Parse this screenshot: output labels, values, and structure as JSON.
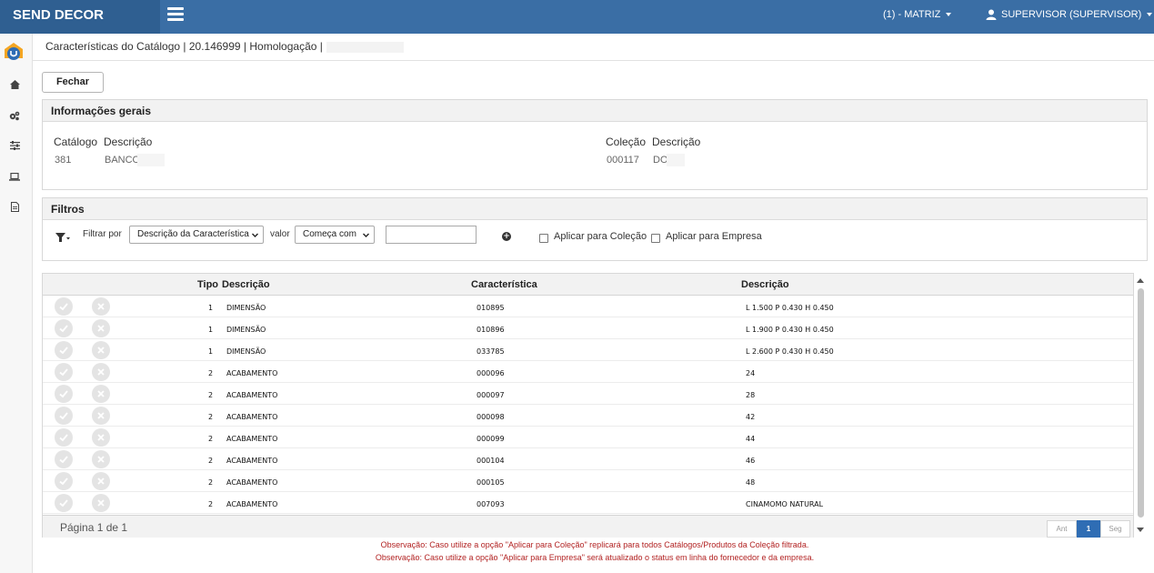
{
  "app": {
    "brand": "SEND DECOR"
  },
  "header": {
    "branch": "(1) - MATRIZ",
    "user": "SUPERVISOR (SUPERVISOR)"
  },
  "sidebar": {
    "items": [
      "logo-icon",
      "home-icon",
      "cogs-icon",
      "sliders-icon",
      "laptop-icon",
      "document-icon"
    ]
  },
  "breadcrumb": "Características do Catálogo | 20.146999 | Homologação |",
  "toolbar": {
    "close_label": "Fechar"
  },
  "info": {
    "title": "Informações gerais",
    "catalog_label": "Catálogo",
    "catalog_desc_label": "Descrição",
    "catalog_value": "381",
    "catalog_desc_value": "BANCO",
    "collection_label": "Coleção",
    "collection_desc_label": "Descrição",
    "collection_value": "000117",
    "collection_desc_value": "DO"
  },
  "filters": {
    "title": "Filtros",
    "filter_by_label": "Filtrar por",
    "filter_by_value": "Descrição da Característica",
    "value_label": "valor",
    "operator_value": "Começa com",
    "input_value": "",
    "apply_collection_label": "Aplicar para Coleção",
    "apply_company_label": "Aplicar para Empresa"
  },
  "table": {
    "columns": [
      "Tipo",
      "Descrição",
      "Característica",
      "Descrição"
    ],
    "rows": [
      {
        "tipo": "1",
        "descricao": "DIMENSÃO",
        "caracteristica": "010895",
        "descricao2": "L 1.500 P 0.430 H 0.450"
      },
      {
        "tipo": "1",
        "descricao": "DIMENSÃO",
        "caracteristica": "010896",
        "descricao2": "L 1.900 P 0.430 H 0.450"
      },
      {
        "tipo": "1",
        "descricao": "DIMENSÃO",
        "caracteristica": "033785",
        "descricao2": "L 2.600 P 0.430 H 0.450"
      },
      {
        "tipo": "2",
        "descricao": "ACABAMENTO",
        "caracteristica": "000096",
        "descricao2": "24"
      },
      {
        "tipo": "2",
        "descricao": "ACABAMENTO",
        "caracteristica": "000097",
        "descricao2": "28"
      },
      {
        "tipo": "2",
        "descricao": "ACABAMENTO",
        "caracteristica": "000098",
        "descricao2": "42"
      },
      {
        "tipo": "2",
        "descricao": "ACABAMENTO",
        "caracteristica": "000099",
        "descricao2": "44"
      },
      {
        "tipo": "2",
        "descricao": "ACABAMENTO",
        "caracteristica": "000104",
        "descricao2": "46"
      },
      {
        "tipo": "2",
        "descricao": "ACABAMENTO",
        "caracteristica": "000105",
        "descricao2": "48"
      },
      {
        "tipo": "2",
        "descricao": "ACABAMENTO",
        "caracteristica": "007093",
        "descricao2": "CINAMOMO NATURAL"
      }
    ],
    "page_info": "Página 1 de 1",
    "pager": {
      "prev": "Ant",
      "current": "1",
      "next": "Seg"
    }
  },
  "notes": [
    "Observação: Caso utilize a opção \"Aplicar para Coleção\" replicará para todos Catálogos/Produtos da Coleção filtrada.",
    "Observação: Caso utilize a opção \"Aplicar para Empresa\" será atualizado o status em linha do fornecedor e da empresa."
  ],
  "colors": {
    "topbar": "#3a6ea5",
    "brand_bg": "#2f5f91",
    "pager_active": "#2f6db4",
    "note_text": "#b22222"
  }
}
